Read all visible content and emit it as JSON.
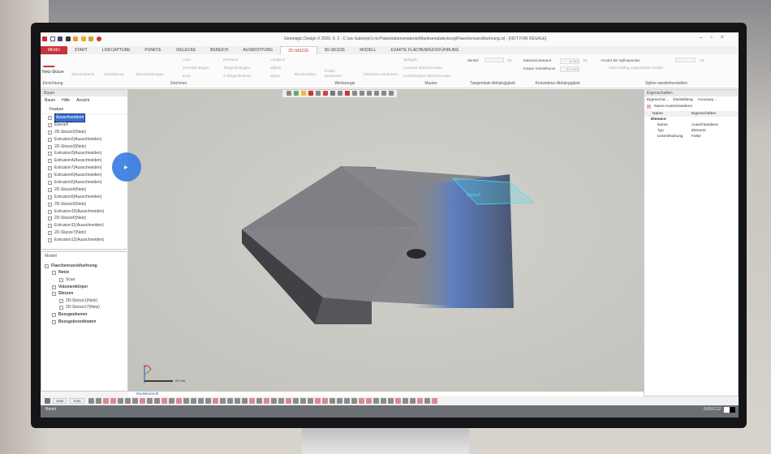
{
  "window": {
    "title": "Geomagic Design X 2020. 0. 2 - C:\\aic-Sales\\rp\\1-rp-Präsentationsmaterial\\Markisenabdeckung\\Flaechenrueckfuehrung.xrl - [NOT FOR RESALE]"
  },
  "tabs": [
    {
      "label": "MENU"
    },
    {
      "label": "START"
    },
    {
      "label": "LIVECAPTURE"
    },
    {
      "label": "PUNKTE"
    },
    {
      "label": "VIELECKE"
    },
    {
      "label": "BEREICH"
    },
    {
      "label": "AUSRICHTUNG"
    },
    {
      "label": "2D-SKIZZE",
      "active": true
    },
    {
      "label": "3D-SKIZZE"
    },
    {
      "label": "MODELL"
    },
    {
      "label": "EXAKTE FLÄCHENRÜCKFÜHRUNG"
    }
  ],
  "ribbon": {
    "netz_skizze": "Netz-Skizze",
    "groups": [
      "Einrichtung",
      "Zeichnen",
      "Werkzeuge",
      "Muster",
      "Tangentiale Abhängigkeit",
      "Koinzidenz-Abhängigkeit",
      "Spline wiederherstellen"
    ],
    "zeichnen_items": [
      "Skizzenebene",
      "Schnittkurve",
      "Beschränkungen",
      "Linie",
      "3-Punkte-Bogen",
      "Kreis",
      "Rechteck",
      "Tangentenbogen",
      "3-Tangentenkreis",
      "Langloch",
      "Ellipse",
      "Spline"
    ],
    "werkzeuge_items": [
      "Beschneiden",
      "Größe",
      "Bearbeiten",
      "Elemente extrahieren"
    ],
    "muster_items": [
      "Spiegeln",
      "Lineares Skizzenmuster",
      "Kreisförmiges Skizzenmuster"
    ],
    "winkel_label": "Winkel",
    "ok": "Ok",
    "max_abstand_label": "Maximal abstand",
    "max_abstand_value": "5 mm",
    "schnittkurve_label": "Körper Schnittkurve",
    "schnittkurve_value": "0.2 mm",
    "spline_label": "Anzahl der Splinepunkte",
    "spline_check": "Gleichmäßig angeordnete Punkte"
  },
  "left_panel": {
    "header": "Baum",
    "tabs": [
      "Baum",
      "Hilfe",
      "Ansicht"
    ],
    "feature_label": "Feature",
    "features": [
      "Ausschneiden4",
      "Ebene5",
      "2D-Skizze2(Netz)",
      "Extrusion2(Ausschneiden)",
      "2D-Skizze3(Netz)",
      "Extrusion3(Ausschneiden)",
      "Extrusion4(Ausschneiden)",
      "Extrusion7(Ausschneiden)",
      "Extrusion6(Ausschneiden)",
      "Extrusion5(Ausschneiden)",
      "2D-Skizze4(Netz)",
      "Extrusion9(Ausschneiden)",
      "2D-Skizze5(Netz)",
      "Extrusion10(Ausschneiden)",
      "2D-Skizze6(Netz)",
      "Extrusion11(Ausschneiden)",
      "2D-Skizze7(Netz)",
      "Extrusion12(Ausschneiden)"
    ],
    "model_label": "Modell",
    "model_tree": [
      {
        "label": "Flaechenrueckfuehrung",
        "level": 0,
        "bold": true
      },
      {
        "label": "Netze",
        "level": 1,
        "bold": true
      },
      {
        "label": "Scan",
        "level": 2
      },
      {
        "label": "Volumenkörper",
        "level": 1,
        "bold": true
      },
      {
        "label": "Skizzen",
        "level": 1,
        "bold": true
      },
      {
        "label": "2D-Skizze1(Netz)",
        "level": 2
      },
      {
        "label": "2D-Skizze17(Netz)",
        "level": 2
      },
      {
        "label": "Bezugsebenen",
        "level": 1,
        "bold": true
      },
      {
        "label": "Bezugskoordinaten",
        "level": 1,
        "bold": true
      }
    ]
  },
  "viewport": {
    "tab": "Modellansicht",
    "scale": "25 mm",
    "plane_label": "Ebene5"
  },
  "right_panel": {
    "header": "Eigenschaften",
    "tabs": [
      "Eigenscha...",
      "Darstellung",
      "Accuracy ..."
    ],
    "name_label": "Name:Ausschneiden4",
    "columns": [
      "Name",
      "Eigenschaften"
    ],
    "group": "Element",
    "rows": [
      {
        "k": "Name",
        "v": "Ausschneiden4"
      },
      {
        "k": "Typ",
        "v": "Element"
      },
      {
        "k": "Unterdrückung",
        "v": "False"
      }
    ]
  },
  "bottom_toolbar": {
    "select_1": "Auto",
    "select_2": "Auto"
  },
  "status": {
    "text": "Bereit",
    "time": "0:00:0.12"
  },
  "colors": {
    "accent": "#c8323a",
    "selection": "#3b6fd0",
    "cursor": "#3a7ee0",
    "plane": "#4fe0e8"
  }
}
